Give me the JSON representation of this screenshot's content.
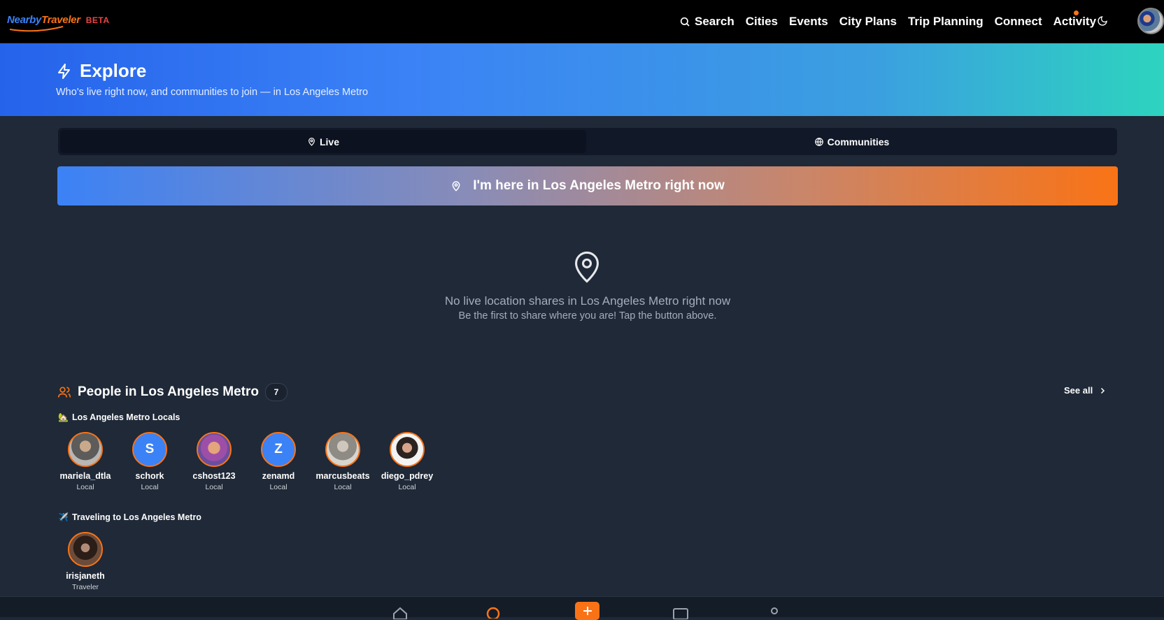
{
  "brand": {
    "name_part1": "Nearby",
    "name_part2": "Traveler",
    "badge": "BETA"
  },
  "nav": {
    "search": "Search",
    "cities": "Cities",
    "events": "Events",
    "city_plans": "City Plans",
    "trip_planning": "Trip Planning",
    "connect": "Connect",
    "activity": "Activity"
  },
  "hero": {
    "title": "Explore",
    "subtitle": "Who's live right now, and communities to join — in Los Angeles Metro"
  },
  "tabs": [
    {
      "label": "Live",
      "icon": "map-pin-icon",
      "active": true
    },
    {
      "label": "Communities",
      "icon": "globe-icon",
      "active": false
    }
  ],
  "checkin_button": {
    "label": "I'm here in Los Angeles Metro right now"
  },
  "empty_state": {
    "title": "No live location shares in Los Angeles Metro right now",
    "subtitle": "Be the first to share where you are! Tap the button above."
  },
  "people": {
    "title": "People in Los Angeles Metro",
    "count": "7",
    "see_all": "See all",
    "locals_label": "Los Angeles Metro Locals",
    "travelers_label": "Traveling to Los Angeles Metro",
    "locals": [
      {
        "name": "mariela_dtla",
        "role": "Local",
        "initial": ""
      },
      {
        "name": "schork",
        "role": "Local",
        "initial": "S"
      },
      {
        "name": "cshost123",
        "role": "Local",
        "initial": ""
      },
      {
        "name": "zenamd",
        "role": "Local",
        "initial": "Z"
      },
      {
        "name": "marcusbeats",
        "role": "Local",
        "initial": ""
      },
      {
        "name": "diego_pdrey",
        "role": "Local",
        "initial": ""
      }
    ],
    "travelers": [
      {
        "name": "irisjaneth",
        "role": "Traveler",
        "initial": ""
      }
    ]
  },
  "colors": {
    "accent_orange": "#f97316",
    "accent_blue": "#3b82f6",
    "background": "#1f2937",
    "hero_teal": "#2dd4bf"
  }
}
